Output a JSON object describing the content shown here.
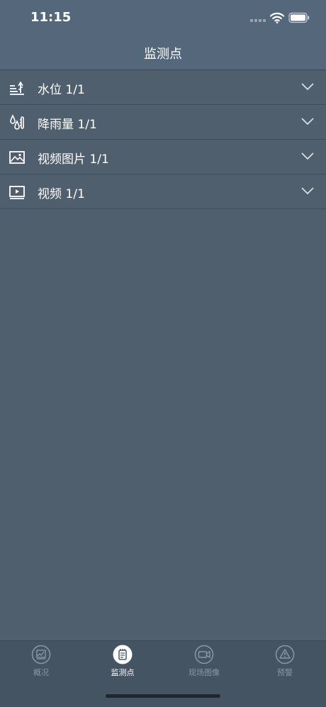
{
  "status_bar": {
    "time": "11:15"
  },
  "header": {
    "title": "监测点"
  },
  "sections": [
    {
      "label": "水位 1/1",
      "icon": "water-level-icon"
    },
    {
      "label": "降雨量 1/1",
      "icon": "rainfall-icon"
    },
    {
      "label": "视频图片 1/1",
      "icon": "image-icon"
    },
    {
      "label": "视频 1/1",
      "icon": "video-icon"
    }
  ],
  "tabs": [
    {
      "label": "概况",
      "icon": "overview-chart-icon",
      "active": false
    },
    {
      "label": "监测点",
      "icon": "monitor-point-icon",
      "active": true
    },
    {
      "label": "现场图像",
      "icon": "camera-icon",
      "active": false
    },
    {
      "label": "预警",
      "icon": "warning-icon",
      "active": false
    }
  ],
  "colors": {
    "background": "#4f5f6e",
    "header": "#55677a",
    "tab_bar": "#445463",
    "inactive_tab": "#8a97a4"
  }
}
